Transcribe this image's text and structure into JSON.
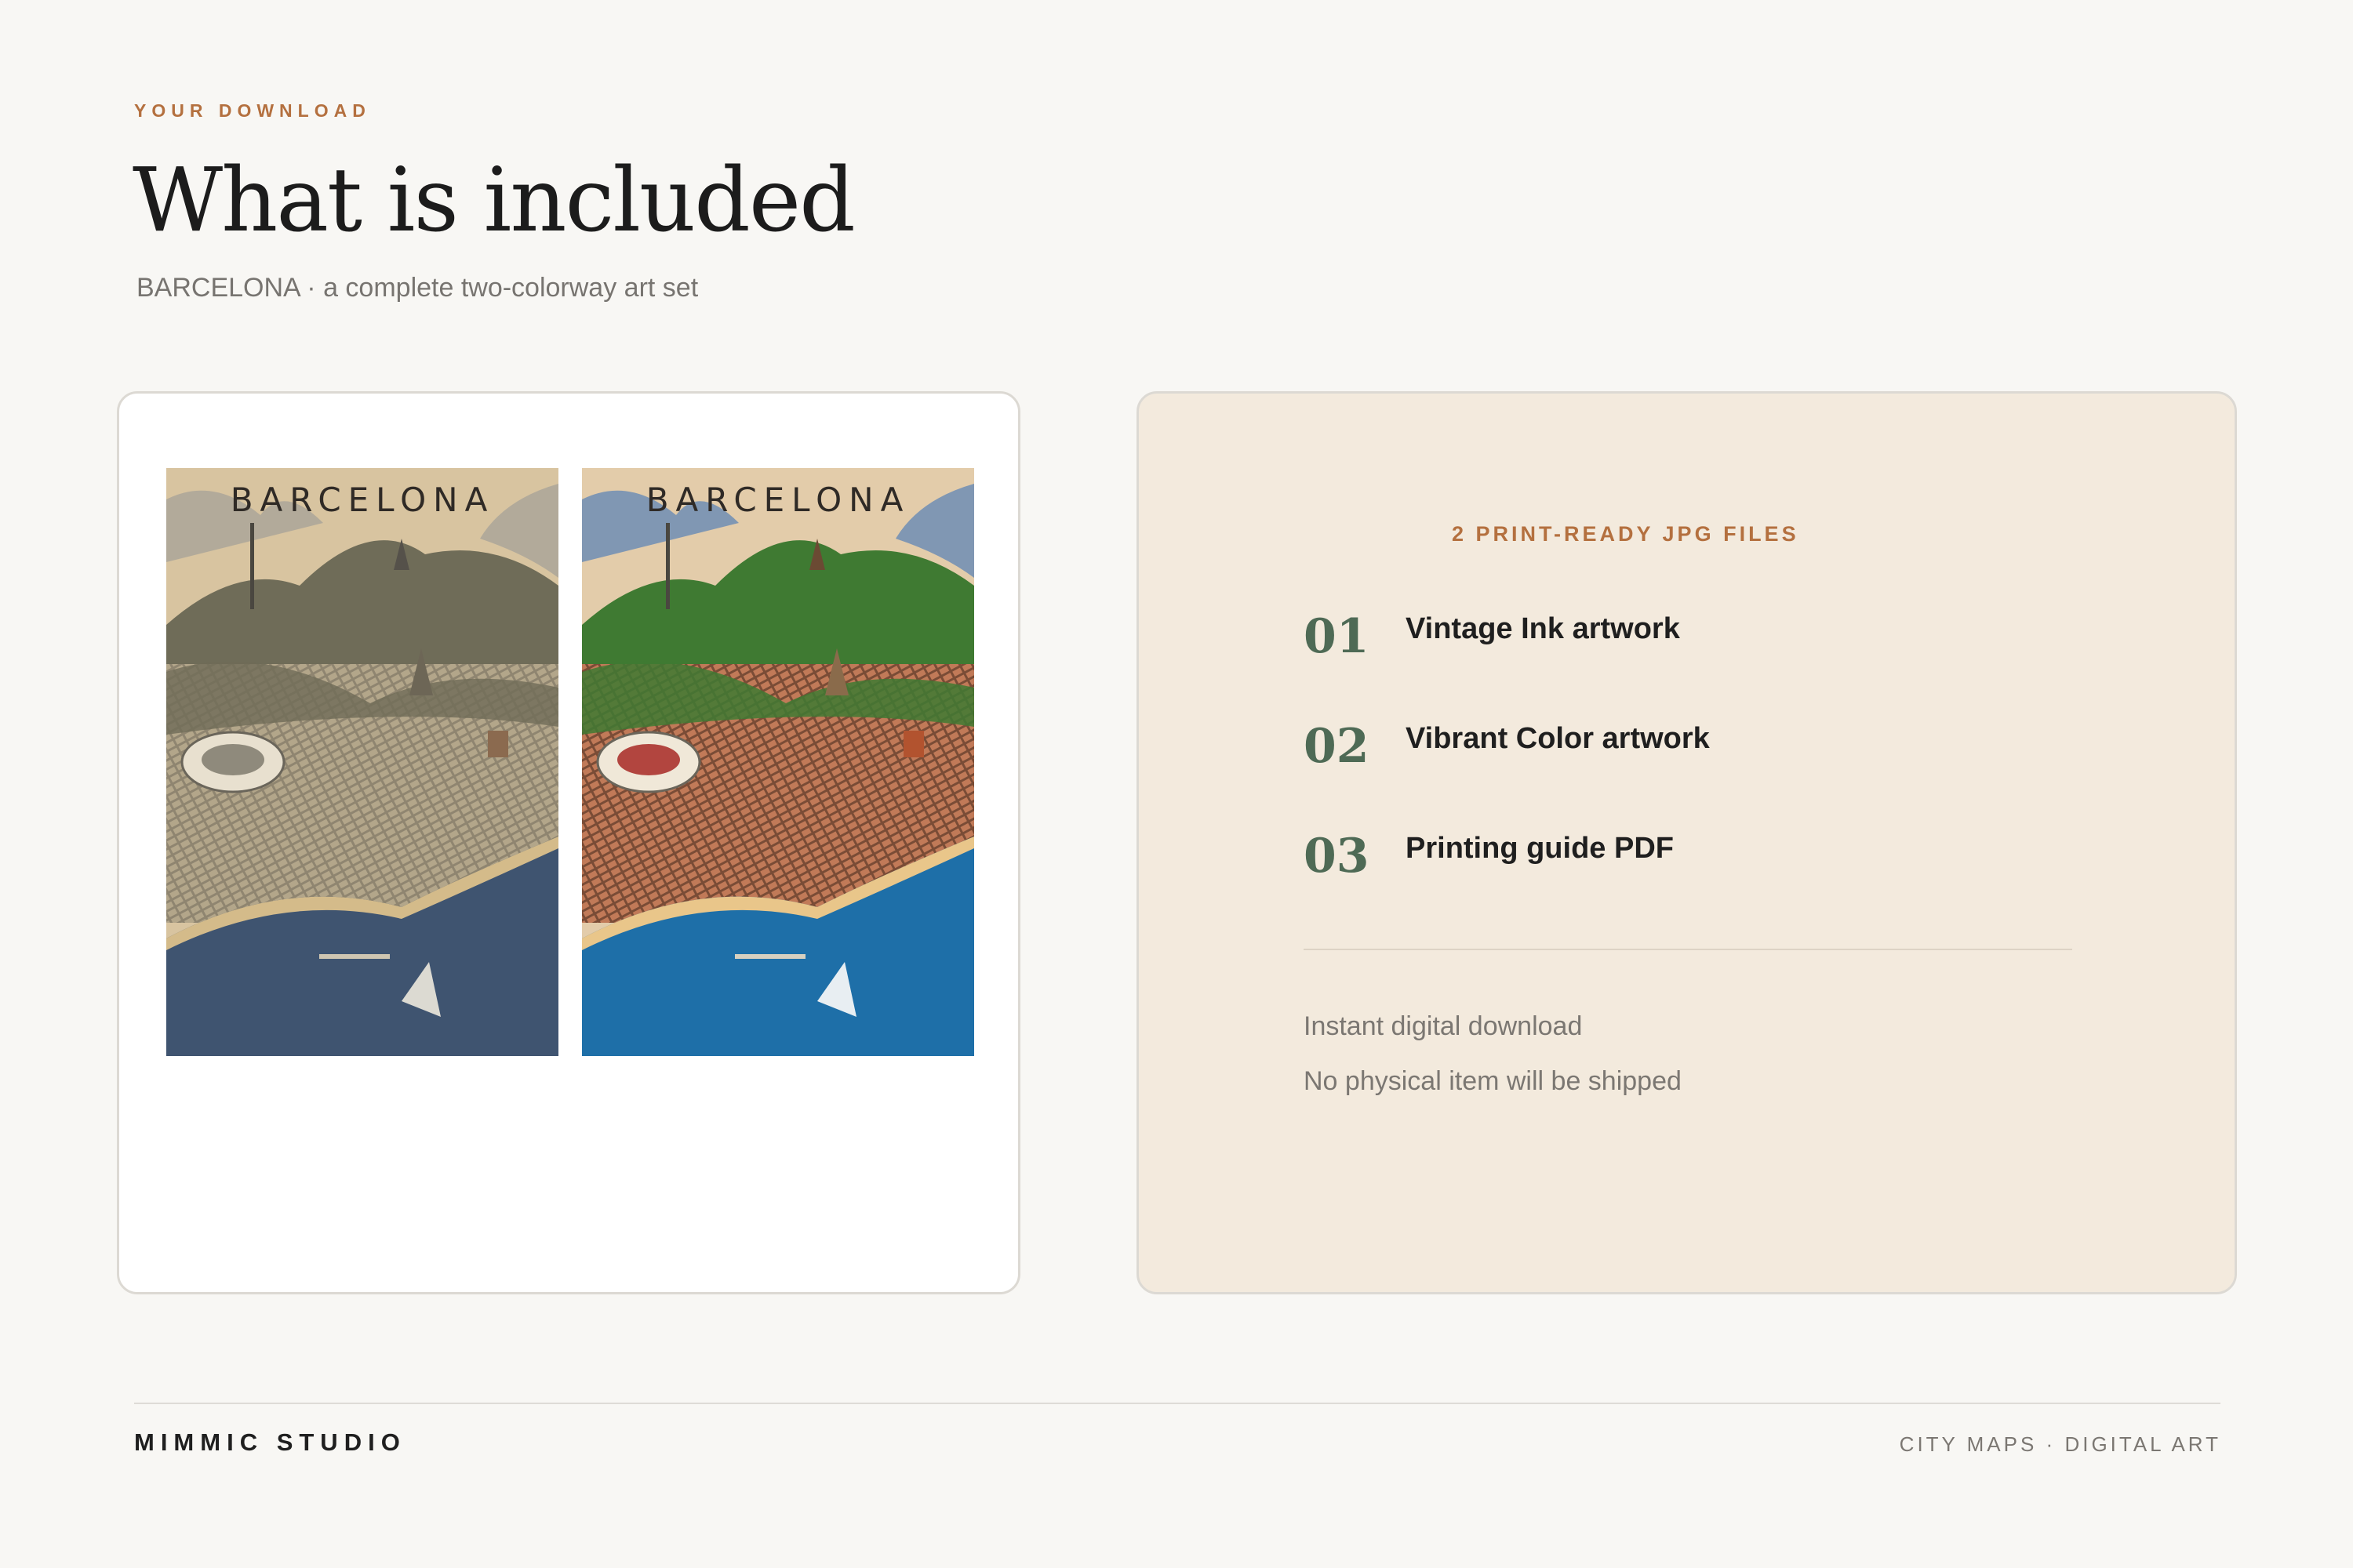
{
  "header": {
    "eyebrow": "YOUR DOWNLOAD",
    "title": "What is included",
    "subtitle": "BARCELONA · a complete two-colorway art set"
  },
  "preview": {
    "posters": [
      {
        "label": "BARCELONA",
        "style": "vintage-ink"
      },
      {
        "label": "BARCELONA",
        "style": "vibrant-color"
      }
    ]
  },
  "files": {
    "heading": "2 PRINT-READY JPG FILES",
    "items": [
      {
        "number": "01",
        "label": "Vintage Ink artwork"
      },
      {
        "number": "02",
        "label": "Vibrant Color artwork"
      },
      {
        "number": "03",
        "label": "Printing guide PDF"
      }
    ],
    "notes": [
      "Instant digital download",
      "No physical item will be shipped"
    ]
  },
  "footer": {
    "brand": "MIMMIC STUDIO",
    "tagline": "CITY MAPS · DIGITAL ART"
  },
  "colors": {
    "accent": "#b4703f",
    "number": "#4e6a55",
    "panel": "#f3eadd",
    "background": "#f8f7f4"
  }
}
